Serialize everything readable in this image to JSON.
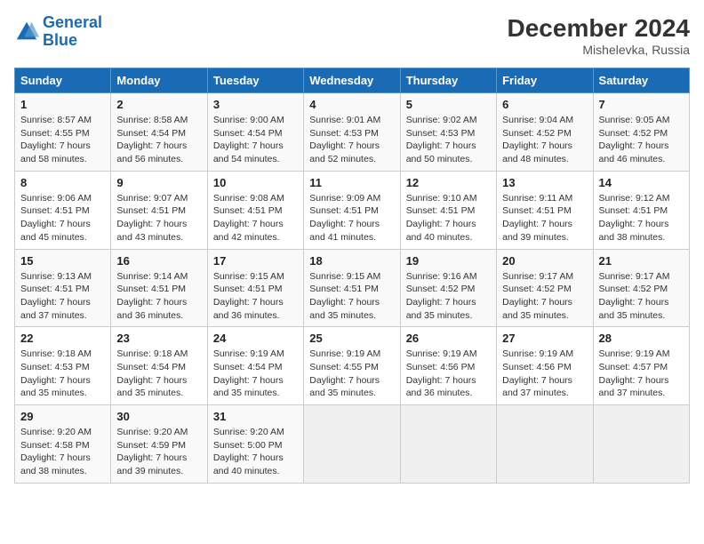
{
  "header": {
    "logo_line1": "General",
    "logo_line2": "Blue",
    "month_year": "December 2024",
    "location": "Mishelevka, Russia"
  },
  "weekdays": [
    "Sunday",
    "Monday",
    "Tuesday",
    "Wednesday",
    "Thursday",
    "Friday",
    "Saturday"
  ],
  "weeks": [
    [
      {
        "day": "1",
        "sunrise": "8:57 AM",
        "sunset": "4:55 PM",
        "daylight": "7 hours and 58 minutes."
      },
      {
        "day": "2",
        "sunrise": "8:58 AM",
        "sunset": "4:54 PM",
        "daylight": "7 hours and 56 minutes."
      },
      {
        "day": "3",
        "sunrise": "9:00 AM",
        "sunset": "4:54 PM",
        "daylight": "7 hours and 54 minutes."
      },
      {
        "day": "4",
        "sunrise": "9:01 AM",
        "sunset": "4:53 PM",
        "daylight": "7 hours and 52 minutes."
      },
      {
        "day": "5",
        "sunrise": "9:02 AM",
        "sunset": "4:53 PM",
        "daylight": "7 hours and 50 minutes."
      },
      {
        "day": "6",
        "sunrise": "9:04 AM",
        "sunset": "4:52 PM",
        "daylight": "7 hours and 48 minutes."
      },
      {
        "day": "7",
        "sunrise": "9:05 AM",
        "sunset": "4:52 PM",
        "daylight": "7 hours and 46 minutes."
      }
    ],
    [
      {
        "day": "8",
        "sunrise": "9:06 AM",
        "sunset": "4:51 PM",
        "daylight": "7 hours and 45 minutes."
      },
      {
        "day": "9",
        "sunrise": "9:07 AM",
        "sunset": "4:51 PM",
        "daylight": "7 hours and 43 minutes."
      },
      {
        "day": "10",
        "sunrise": "9:08 AM",
        "sunset": "4:51 PM",
        "daylight": "7 hours and 42 minutes."
      },
      {
        "day": "11",
        "sunrise": "9:09 AM",
        "sunset": "4:51 PM",
        "daylight": "7 hours and 41 minutes."
      },
      {
        "day": "12",
        "sunrise": "9:10 AM",
        "sunset": "4:51 PM",
        "daylight": "7 hours and 40 minutes."
      },
      {
        "day": "13",
        "sunrise": "9:11 AM",
        "sunset": "4:51 PM",
        "daylight": "7 hours and 39 minutes."
      },
      {
        "day": "14",
        "sunrise": "9:12 AM",
        "sunset": "4:51 PM",
        "daylight": "7 hours and 38 minutes."
      }
    ],
    [
      {
        "day": "15",
        "sunrise": "9:13 AM",
        "sunset": "4:51 PM",
        "daylight": "7 hours and 37 minutes."
      },
      {
        "day": "16",
        "sunrise": "9:14 AM",
        "sunset": "4:51 PM",
        "daylight": "7 hours and 36 minutes."
      },
      {
        "day": "17",
        "sunrise": "9:15 AM",
        "sunset": "4:51 PM",
        "daylight": "7 hours and 36 minutes."
      },
      {
        "day": "18",
        "sunrise": "9:15 AM",
        "sunset": "4:51 PM",
        "daylight": "7 hours and 35 minutes."
      },
      {
        "day": "19",
        "sunrise": "9:16 AM",
        "sunset": "4:52 PM",
        "daylight": "7 hours and 35 minutes."
      },
      {
        "day": "20",
        "sunrise": "9:17 AM",
        "sunset": "4:52 PM",
        "daylight": "7 hours and 35 minutes."
      },
      {
        "day": "21",
        "sunrise": "9:17 AM",
        "sunset": "4:52 PM",
        "daylight": "7 hours and 35 minutes."
      }
    ],
    [
      {
        "day": "22",
        "sunrise": "9:18 AM",
        "sunset": "4:53 PM",
        "daylight": "7 hours and 35 minutes."
      },
      {
        "day": "23",
        "sunrise": "9:18 AM",
        "sunset": "4:54 PM",
        "daylight": "7 hours and 35 minutes."
      },
      {
        "day": "24",
        "sunrise": "9:19 AM",
        "sunset": "4:54 PM",
        "daylight": "7 hours and 35 minutes."
      },
      {
        "day": "25",
        "sunrise": "9:19 AM",
        "sunset": "4:55 PM",
        "daylight": "7 hours and 35 minutes."
      },
      {
        "day": "26",
        "sunrise": "9:19 AM",
        "sunset": "4:56 PM",
        "daylight": "7 hours and 36 minutes."
      },
      {
        "day": "27",
        "sunrise": "9:19 AM",
        "sunset": "4:56 PM",
        "daylight": "7 hours and 37 minutes."
      },
      {
        "day": "28",
        "sunrise": "9:19 AM",
        "sunset": "4:57 PM",
        "daylight": "7 hours and 37 minutes."
      }
    ],
    [
      {
        "day": "29",
        "sunrise": "9:20 AM",
        "sunset": "4:58 PM",
        "daylight": "7 hours and 38 minutes."
      },
      {
        "day": "30",
        "sunrise": "9:20 AM",
        "sunset": "4:59 PM",
        "daylight": "7 hours and 39 minutes."
      },
      {
        "day": "31",
        "sunrise": "9:20 AM",
        "sunset": "5:00 PM",
        "daylight": "7 hours and 40 minutes."
      },
      null,
      null,
      null,
      null
    ]
  ]
}
